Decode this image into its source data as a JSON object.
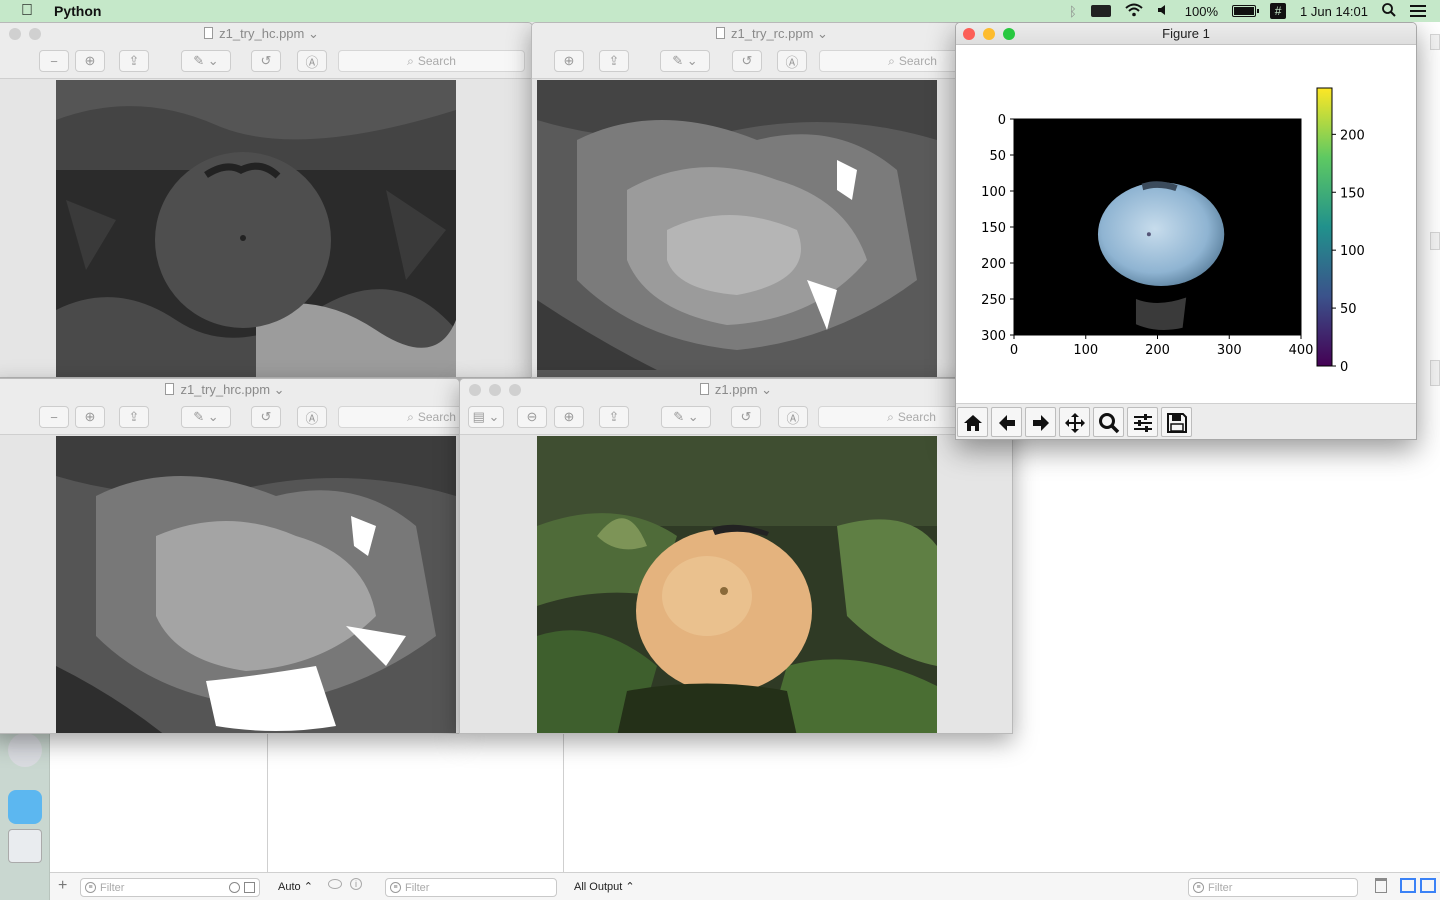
{
  "menubar": {
    "app_name": "Python",
    "battery": "100%",
    "datetime": "1 Jun  14:01"
  },
  "preview_windows": [
    {
      "title": "z1_try_hc.ppm",
      "search_placeholder": "Search"
    },
    {
      "title": "z1_try_rc.ppm",
      "search_placeholder": "Search"
    },
    {
      "title": "z1_try_hrc.ppm",
      "search_placeholder": "Search"
    },
    {
      "title": "z1.ppm",
      "search_placeholder": "Search"
    }
  ],
  "figure": {
    "title": "Figure 1",
    "colorbar": {
      "colormap": "viridis",
      "range": [
        0,
        240
      ],
      "tick_labels": [
        "0",
        "50",
        "100",
        "150",
        "200"
      ]
    },
    "toolbar": [
      "home-icon",
      "back-arrow-icon",
      "forward-arrow-icon",
      "pan-icon",
      "zoom-icon",
      "configure-subplots-icon",
      "save-icon"
    ]
  },
  "chart_data": {
    "type": "heatmap",
    "title": "",
    "xlabel": "",
    "ylabel": "",
    "xlim": [
      0,
      400
    ],
    "ylim": [
      300,
      0
    ],
    "xticks": [
      "0",
      "100",
      "200",
      "300",
      "400"
    ],
    "yticks": [
      "0",
      "50",
      "100",
      "150",
      "200",
      "250",
      "300"
    ],
    "colorbar_ticks": [
      "0",
      "50",
      "100",
      "150",
      "200"
    ],
    "colorbar_range": [
      0,
      240
    ],
    "colormap": "viridis",
    "grid": false
  },
  "ide": {
    "bottom_bar": {
      "filter_placeholder_left": "Filter",
      "auto_label": "Auto",
      "filter_placeholder_middle": "Filter",
      "output_label": "All Output",
      "filter_placeholder_right": "Filter"
    }
  },
  "colors": {
    "menubar_bg": "#c5e8c9",
    "close": "#fc5f57",
    "minimize": "#fdbc2e",
    "zoom": "#28c840",
    "colorbar_top": "#fde725",
    "colorbar_bottom": "#440154"
  }
}
